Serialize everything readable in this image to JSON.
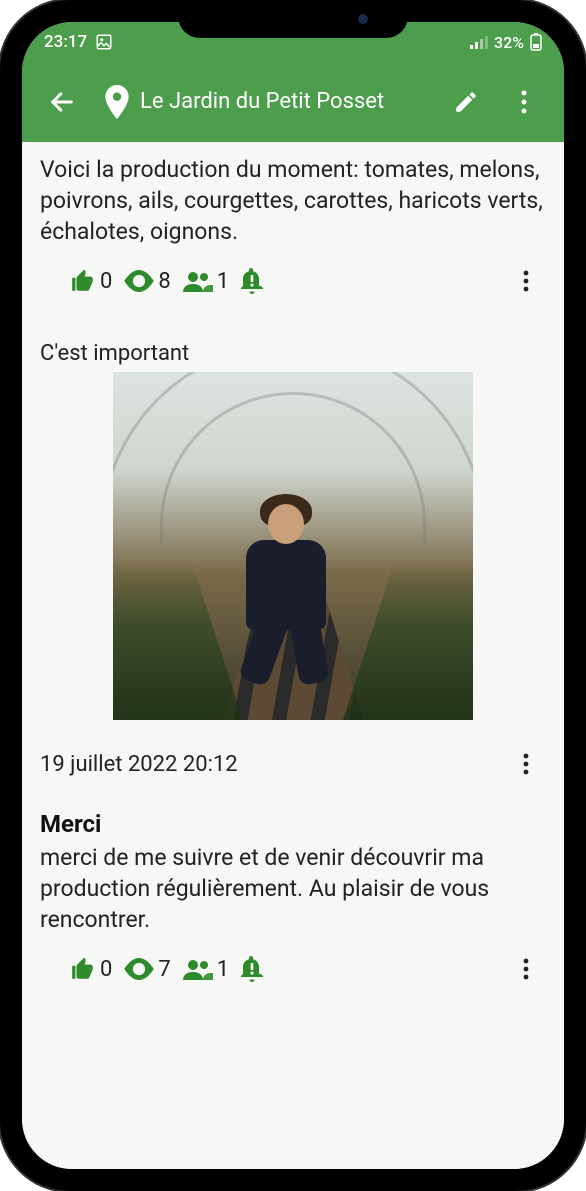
{
  "status": {
    "time": "23:17",
    "battery_pct": "32%"
  },
  "header": {
    "title": "Le Jardin du Petit Posset"
  },
  "post1": {
    "body": "Voici la production du moment: tomates, melons, poivrons, ails, courgettes, carottes, haricots verts, échalotes, oignons.",
    "likes": "0",
    "views": "8",
    "users": "1",
    "section_label": "C'est important"
  },
  "post2": {
    "timestamp": "19 juillet 2022 20:12",
    "title": "Merci",
    "body": "merci de me suivre et de venir découvrir ma production régulièrement. Au plaisir de vous rencontrer.",
    "likes": "0",
    "views": "7",
    "users": "1"
  }
}
